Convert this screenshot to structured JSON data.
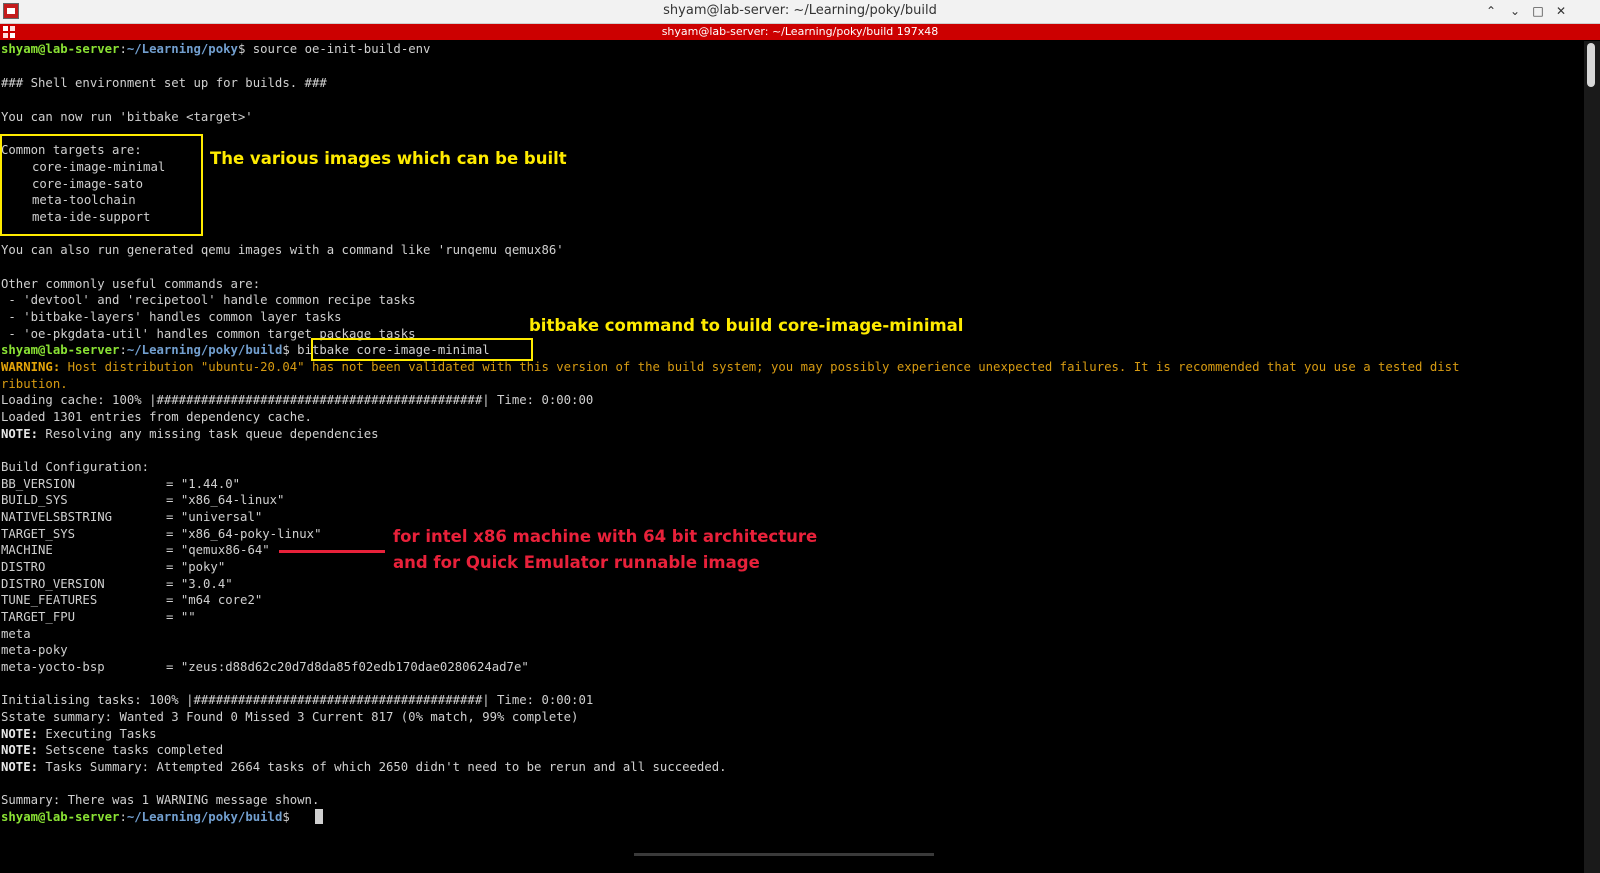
{
  "window": {
    "title": "shyam@lab-server: ~/Learning/poky/build",
    "minimize_icon": "chevron-up",
    "restore_icon": "chevron-down",
    "maximize_icon": "square",
    "close_icon": "x-mark"
  },
  "tab": {
    "title": "shyam@lab-server: ~/Learning/poky/build 197x48"
  },
  "colors": {
    "tab_bar": "#cc0000",
    "prompt_user": "#8ae234",
    "prompt_path": "#729fcf",
    "warning": "#e5a50a",
    "annotation_yellow": "#ffeb00",
    "annotation_red": "#e8213a"
  },
  "prompt": {
    "user_host": "shyam@lab-server",
    "path_home": "~/Learning/poky",
    "path_build": "~/Learning/poky/build"
  },
  "terminal": {
    "cmd1": "source oe-init-build-env",
    "env_setup": "### Shell environment set up for builds. ###",
    "run_hint": "You can now run 'bitbake <target>'",
    "targets_header": "Common targets are:",
    "targets": [
      "core-image-minimal",
      "core-image-sato",
      "meta-toolchain",
      "meta-ide-support"
    ],
    "qemu_hint": "You can also run generated qemu images with a command like 'runqemu qemux86'",
    "other_cmds_header": "Other commonly useful commands are:",
    "other_cmds": [
      " - 'devtool' and 'recipetool' handle common recipe tasks",
      " - 'bitbake-layers' handles common layer tasks",
      " - 'oe-pkgdata-util' handles common target package tasks"
    ],
    "cmd2": "bitbake core-image-minimal",
    "warning_label": "WARNING:",
    "warning_text": " Host distribution \"ubuntu-20.04\" has not been validated with this version of the build system; you may possibly experience unexpected failures. It is recommended that you use a tested dist",
    "warning_cont": "ribution.",
    "loading_cache": "Loading cache: 100% |############################################| Time: 0:00:00",
    "loaded_entries": "Loaded 1301 entries from dependency cache.",
    "note_label": "NOTE:",
    "note_resolving": " Resolving any missing task queue dependencies",
    "build_config_header": "Build Configuration:",
    "config": [
      {
        "key": "BB_VERSION",
        "value": "\"1.44.0\""
      },
      {
        "key": "BUILD_SYS",
        "value": "\"x86_64-linux\""
      },
      {
        "key": "NATIVELSBSTRING",
        "value": "\"universal\""
      },
      {
        "key": "TARGET_SYS",
        "value": "\"x86_64-poky-linux\""
      },
      {
        "key": "MACHINE",
        "value": "\"qemux86-64\""
      },
      {
        "key": "DISTRO",
        "value": "\"poky\""
      },
      {
        "key": "DISTRO_VERSION",
        "value": "\"3.0.4\""
      },
      {
        "key": "TUNE_FEATURES",
        "value": "\"m64 core2\""
      },
      {
        "key": "TARGET_FPU",
        "value": "\"\""
      }
    ],
    "layers": [
      {
        "key": "meta",
        "value": ""
      },
      {
        "key": "meta-poky",
        "value": ""
      },
      {
        "key": "meta-yocto-bsp",
        "value": "\"zeus:d88d62c20d7d8da85f02edb170dae0280624ad7e\""
      }
    ],
    "init_tasks": "Initialising tasks: 100% |#######################################| Time: 0:00:01",
    "sstate_summary": "Sstate summary: Wanted 3 Found 0 Missed 3 Current 817 (0% match, 99% complete)",
    "note_executing": " Executing Tasks",
    "note_setscene": " Setscene tasks completed",
    "note_tasks_summary": " Tasks Summary: Attempted 2664 tasks of which 2650 didn't need to be rerun and all succeeded.",
    "summary": "Summary: There was 1 WARNING message shown."
  },
  "annotations": {
    "images": "The various images which can be built",
    "bitbake": "bitbake command to build core-image-minimal",
    "machine_line1": "for intel x86 machine with 64 bit architecture",
    "machine_line2": "and for Quick Emulator runnable image"
  }
}
